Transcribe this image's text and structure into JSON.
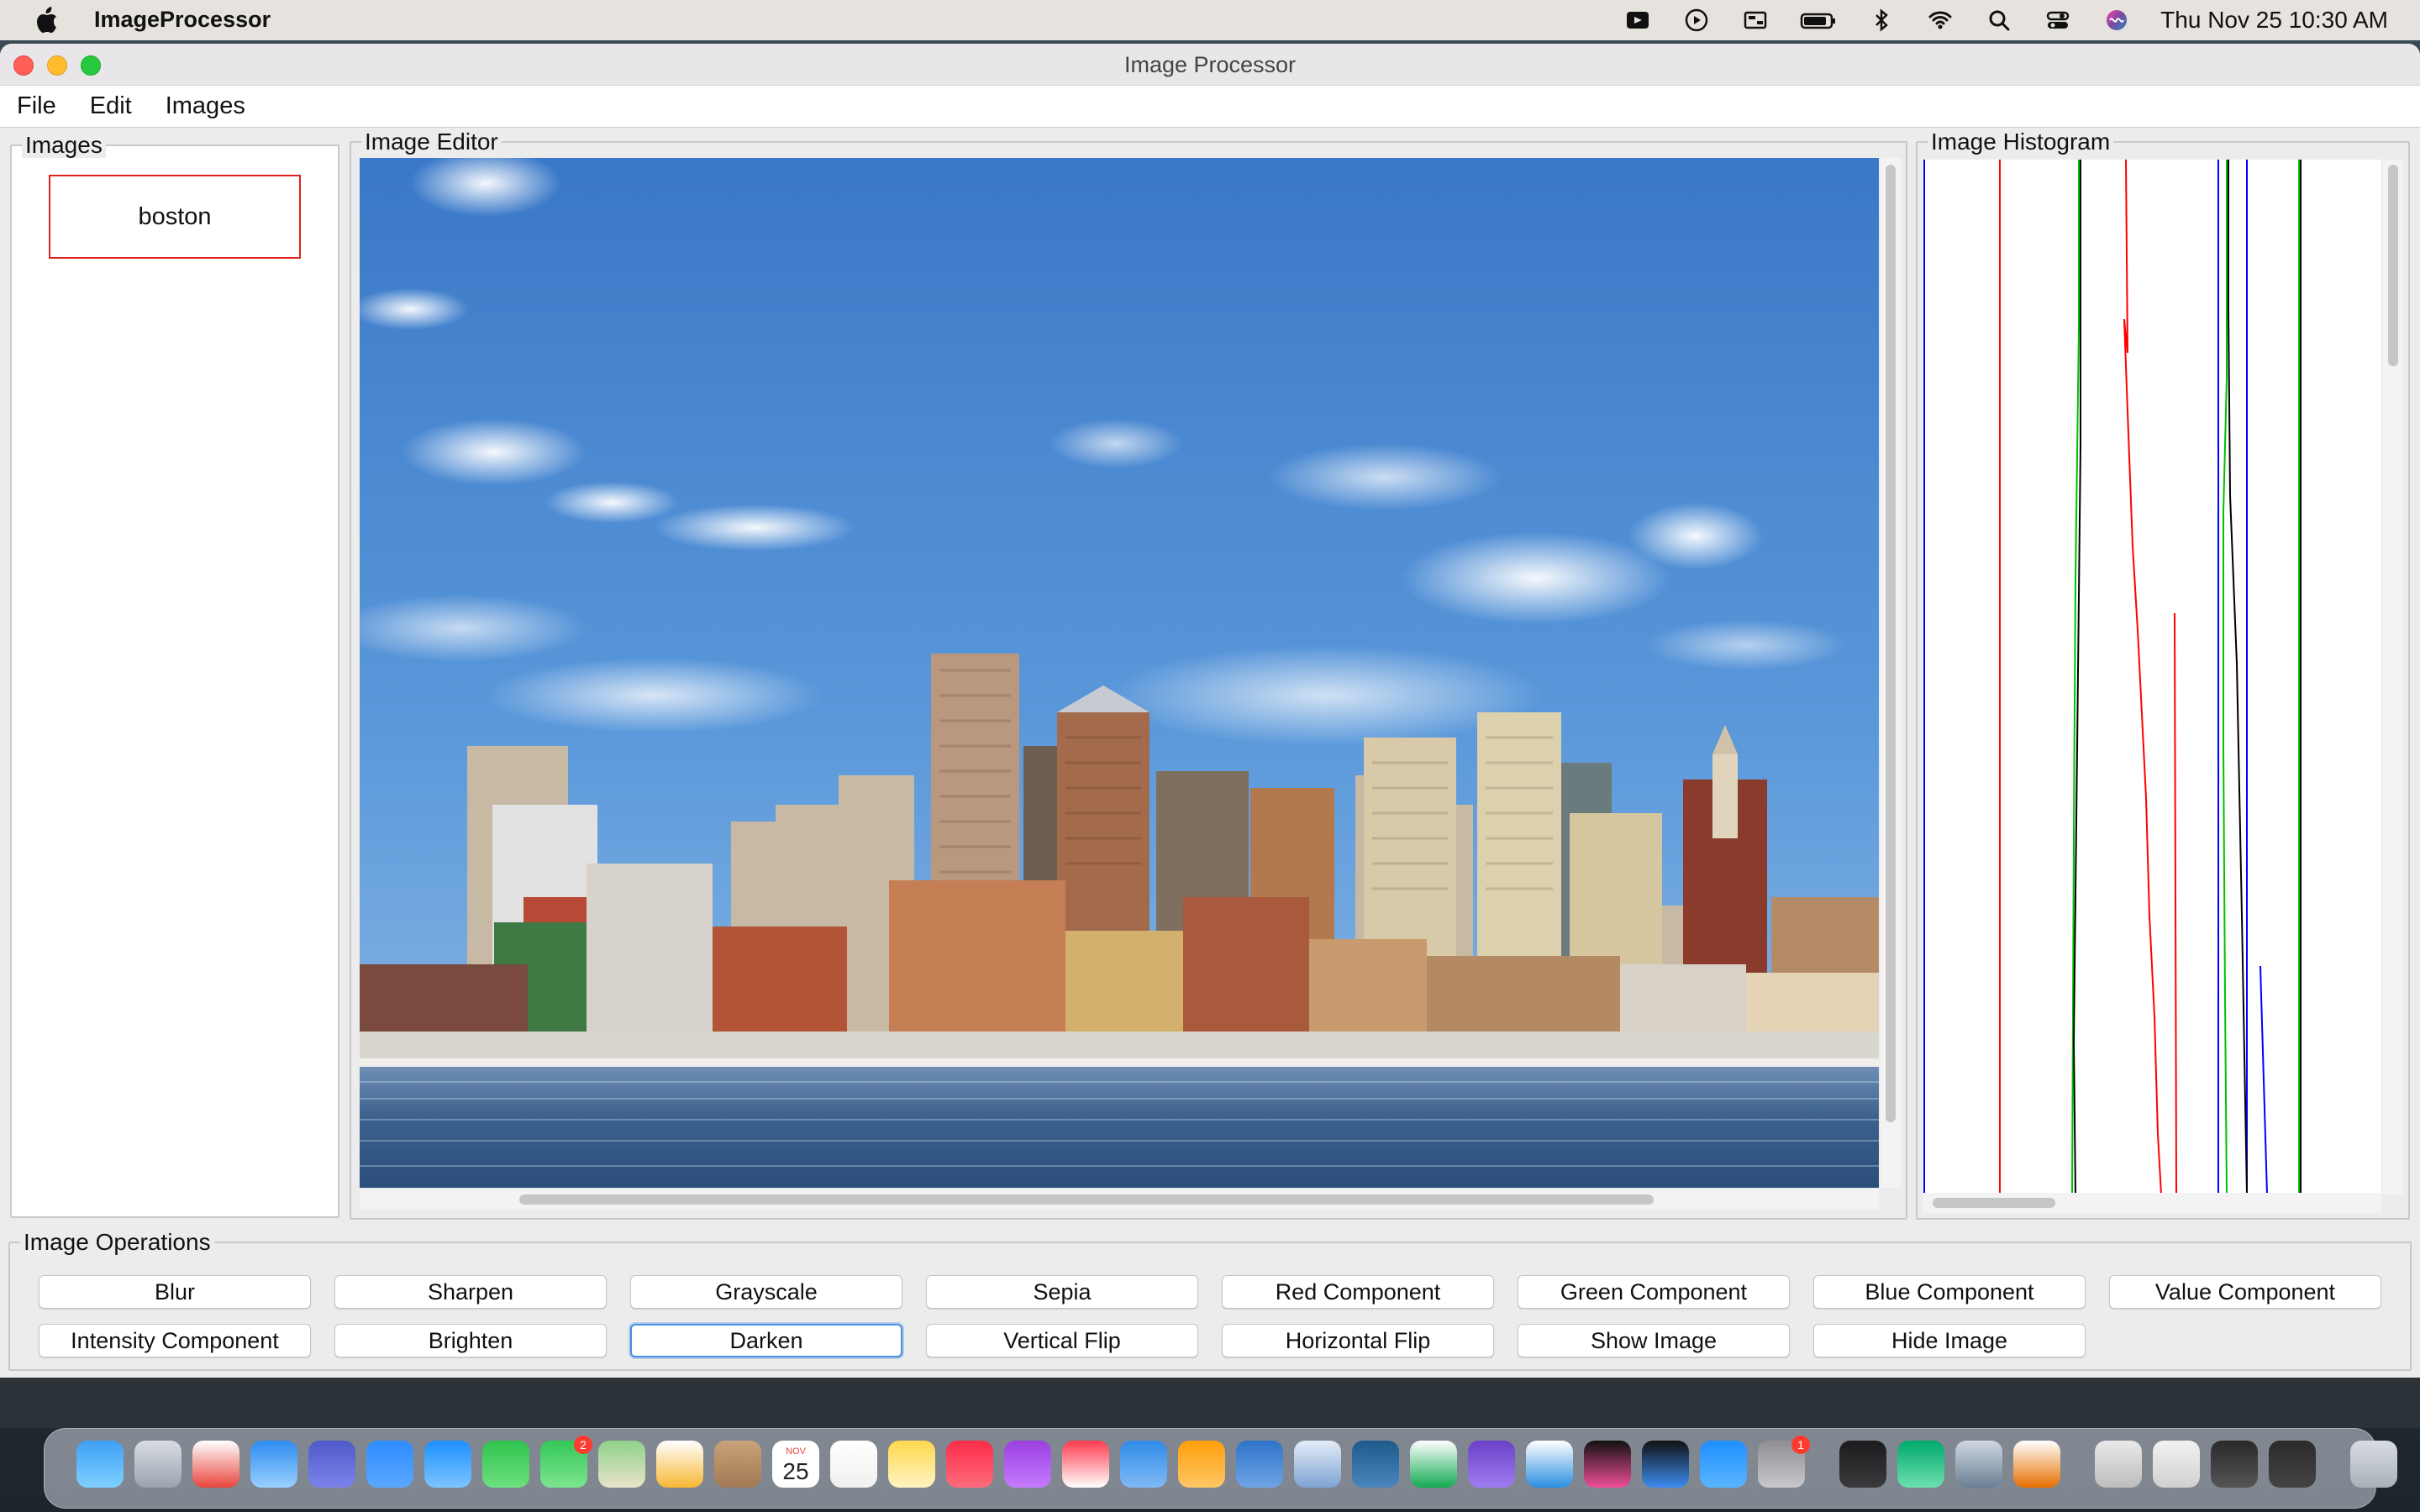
{
  "menubar": {
    "app_name": "ImageProcessor",
    "clock": "Thu Nov 25  10:30 AM"
  },
  "window": {
    "title": "Image Processor",
    "menus": [
      "File",
      "Edit",
      "Images"
    ]
  },
  "images_panel": {
    "legend": "Images",
    "items": [
      "boston"
    ]
  },
  "editor": {
    "legend": "Image Editor",
    "image_name": "boston"
  },
  "histogram": {
    "legend": "Image Histogram",
    "series_colors": {
      "red": "#ff0000",
      "green": "#00c000",
      "blue": "#0000ff",
      "intensity": "#000000"
    }
  },
  "operations": {
    "legend": "Image Operations",
    "row1": [
      "Blur",
      "Sharpen",
      "Grayscale",
      "Sepia",
      "Red Component",
      "Green Component",
      "Blue Component",
      "Value Component"
    ],
    "row2": [
      "Intensity Component",
      "Brighten",
      "Darken",
      "Vertical Flip",
      "Horizontal Flip",
      "Show Image",
      "Hide Image"
    ],
    "focused": "Darken"
  },
  "dock": {
    "calendar_month": "NOV",
    "calendar_day": "25",
    "messages_badge": "2",
    "settings_badge": "1",
    "apps": [
      "finder-icon",
      "launchpad-icon",
      "chrome-icon",
      "safari-icon",
      "teams-icon",
      "zoom-icon",
      "mail-icon",
      "facetime-icon",
      "messages-icon",
      "maps-icon",
      "photos-icon",
      "contacts-icon",
      "calendar-icon",
      "reminders-icon",
      "notes-icon",
      "music-icon",
      "podcasts-icon",
      "news-icon",
      "keynote-icon",
      "pages-icon",
      "network-icon",
      "tableau-icon",
      "mysql-icon",
      "mongodb-icon",
      "obsidian-icon",
      "vscode-icon",
      "intellij-icon",
      "intellij-ce-icon",
      "appstore-icon",
      "settings-icon",
      "terminal-icon",
      "sourcetree-icon",
      "preview-icon",
      "java-icon",
      "window-thumb-1",
      "window-thumb-2",
      "window-thumb-3",
      "window-thumb-4",
      "trash-icon"
    ]
  },
  "colors": {
    "selection_border": "#e02020",
    "focus_ring": "#4a8fe0"
  }
}
